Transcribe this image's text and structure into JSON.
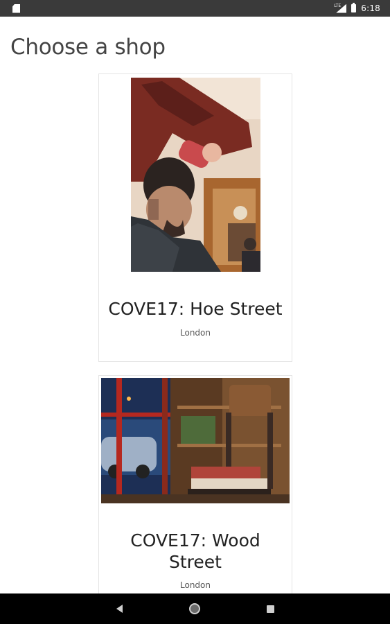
{
  "status_bar": {
    "time": "6:18",
    "network_label": "LTE",
    "icons": [
      "sd-card-icon",
      "lte-signal-icon",
      "battery-icon"
    ]
  },
  "header": {
    "title": "Choose a shop"
  },
  "shops": [
    {
      "name": "COVE17: Hoe Street",
      "city": "London",
      "image": "barber-cutting-hair-photo"
    },
    {
      "name": "COVE17: Wood Street",
      "city": "London",
      "image": "barbershop-interior-chair-photo"
    }
  ],
  "nav_bar": {
    "icons": [
      "back-icon",
      "home-icon",
      "recents-icon"
    ]
  },
  "colors": {
    "status_bar_bg": "#3a3a3a",
    "nav_bar_bg": "#000000",
    "card_border": "#e4e4e4",
    "title_text": "#444444"
  }
}
